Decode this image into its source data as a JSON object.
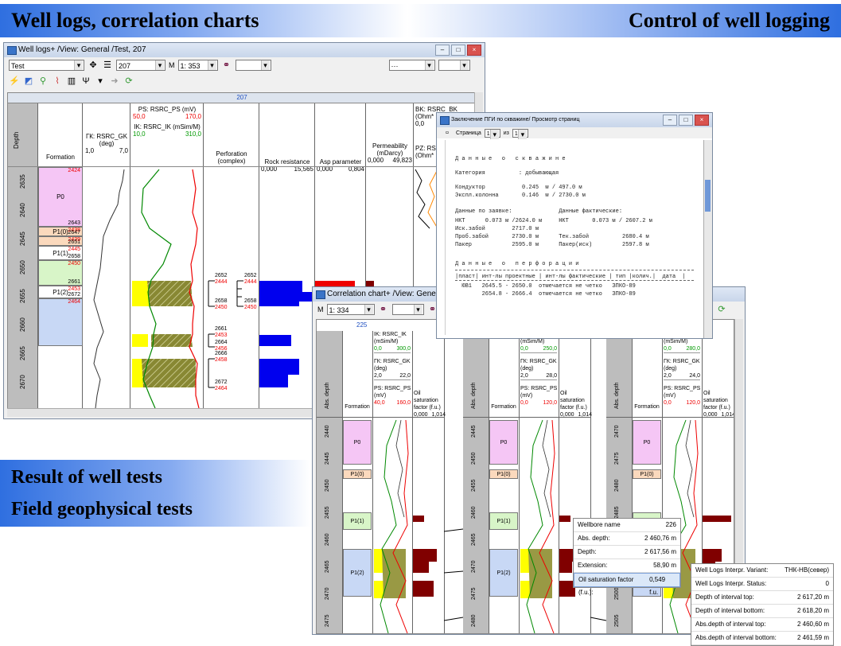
{
  "banners": {
    "top_left": "Well logs, correlation charts",
    "top_right": "Control of well logging",
    "lower_1": "Result of well tests",
    "lower_2": "Field geophysical tests"
  },
  "wl": {
    "title": "Well logs+ /View: General /Test, 207",
    "combo_test": "Test",
    "combo_well": "207",
    "scale_label": "M",
    "scale_value": "1: 353",
    "combo_dots": "···",
    "well_no": "207",
    "columns": {
      "depth": "Depth",
      "formation": "Formation",
      "gk_name": "ГК: RSRC_GK",
      "gk_unit": "(deg)",
      "gk_min": "1,0",
      "gk_max": "7,0",
      "ps_name": "PS: RSRC_PS (mV)",
      "ps_min": "50,0",
      "ps_max": "170,0",
      "ik_name": "IK: RSRC_IK (mSim/M)",
      "ik_min": "10,0",
      "ik_max": "310,0",
      "perf_1": "Perforation",
      "perf_2": "(complex)",
      "rock": "Rock resistance",
      "rock_min": "0,000",
      "rock_max": "15,565",
      "asp": "Asp parameter",
      "asp_min": "0,000",
      "asp_max": "0,804",
      "perm_1": "Permeability",
      "perm_2": "(mDarcy)",
      "perm_min": "0,000",
      "perm_max": "49,823",
      "bk_1": "BK: RSRC_BK",
      "bk_2": "(Ohm*",
      "bk_min": "0,0",
      "pz_1": "PZ: RS",
      "pz_2": "(Ohm*"
    },
    "depth_ticks": [
      "2635",
      "2640",
      "2645",
      "2650",
      "2655",
      "2660",
      "2665",
      "2670"
    ],
    "zones": [
      {
        "name": "P0",
        "top": "2424",
        "bottom": "2643"
      },
      {
        "name": "P1(0)",
        "top": "2438",
        "bottom": "2647"
      },
      {
        "name": "",
        "top": "2439",
        "bottom": "2651"
      },
      {
        "name": "P1(1)",
        "top": "2445",
        "bottom": "2658"
      },
      {
        "name": "",
        "top": "2450",
        "bottom": "2661"
      },
      {
        "name": "P1(2)",
        "top": "2453",
        "bottom": "2672"
      },
      {
        "name": "",
        "top": "2464",
        "bottom": ""
      }
    ],
    "perf_marks_a": [
      {
        "black": "2652",
        "red": "2444"
      },
      {
        "black": "2658",
        "red": "2450"
      },
      {
        "black": "2661",
        "red": "2453"
      },
      {
        "black": "2664",
        "red": "2456"
      },
      {
        "black": "2666",
        "red": "2458"
      },
      {
        "black": "2672",
        "red": "2464"
      }
    ],
    "perf_marks_b": [
      {
        "black": "2652",
        "red": "2444"
      },
      {
        "black": "2658",
        "red": "2450"
      }
    ]
  },
  "report": {
    "title": "Заключение ПГИ по скважине/ Просмотр страниц",
    "page_label": "Страница",
    "page_no": "1",
    "page_of": "из",
    "page_total": "1",
    "lines": [
      "Д а н н ы е   о   с к в а ж и н е",
      "Категория          : добывающая",
      "Кондуктор           0.245  м / 497.0 м",
      "Экспл.колонна       0.146  м / 2730.0 м",
      "Данные по заявке:              Данные фактические:",
      "НКТ      0.073 м /2624.0 м     НКТ       0.073 м / 2607.2 м",
      "Иск.забой        2717.0 м",
      "Проб.забой       2730.0 м      Тек.забой          2680.4 м",
      "Пакер            2595.0 м      Пакер(иск)         2597.8 м",
      "Д а н н ы е   о   п е р ф о р а ц и и",
      "|пласт| инт-лы проектные | инт-лы фактические | тип |колич.|  дата  |",
      "  ЮВ1   2645.5 - 2650.0  отмечается не четко   ЗПКО-89",
      "        2654.8 - 2666.4  отмечается не четко   ЗПКО-89"
    ]
  },
  "cc": {
    "title": "Correlation chart+ /View: General /Test, 225",
    "scale_label": "M",
    "scale_value": "1: 334",
    "well_no": "225",
    "abs_depth": "Abs. depth",
    "formation": "Formation",
    "ik_1": "IK: RSRC_IK",
    "ik_2": "(mSim/M)",
    "ik_min": "0,0",
    "ik_max": "300,0",
    "gk_1": "ГК: RSRC_GK",
    "gk_2": "(deg)",
    "gk_min": "2,0",
    "gk_max": "22,0",
    "ps_1": "PS: RSRC_PS",
    "ps_2": "(mV)",
    "ps_min": "40,0",
    "ps_max": "160,0",
    "osf_1": "Oil saturation",
    "osf_2": "factor (f.u.)",
    "osf_min": "0,000",
    "osf_max": "1,014",
    "w2": {
      "ik_max": "250,0",
      "ik_2": "(mSim/M)",
      "gk_max": "28,0",
      "ps_min": "0,0",
      "ps_max": "120,0"
    },
    "w3": {
      "ik_max": "280,0",
      "gk_max": "24,0",
      "ps_min": "0,0",
      "ps_max": "120,0"
    },
    "ticks_1": [
      "2440",
      "2445",
      "2450",
      "2455",
      "2460",
      "2465",
      "2470",
      "2475"
    ],
    "ticks_2": [
      "2445",
      "2450",
      "2455",
      "2460",
      "2465",
      "2470",
      "2475",
      "2480"
    ],
    "ticks_3": [
      "2470",
      "2475",
      "2480",
      "2485",
      "2490",
      "2495",
      "2500",
      "2505"
    ],
    "zone_names": [
      "P0",
      "P1(0)",
      "P1(1)",
      "P1(2)"
    ]
  },
  "tooltip_a": {
    "rows": [
      {
        "k": "Wellbore name",
        "v": "226"
      },
      {
        "k": "Abs. depth:",
        "v": "2 460,76 m"
      },
      {
        "k": "Depth:",
        "v": "2 617,56 m"
      },
      {
        "k": "Extension:",
        "v": "58,90 m"
      },
      {
        "k": "Oil saturation factor (f.u.):",
        "v": "0,549 f.u."
      }
    ]
  },
  "tooltip_b": {
    "rows": [
      {
        "k": "Well Logs Interpr. Variant:",
        "v": "ТНК-НВ(север)"
      },
      {
        "k": "Well Logs Interpr. Status:",
        "v": "0"
      },
      {
        "k": "Depth of interval top:",
        "v": "2 617,20 m"
      },
      {
        "k": "Depth of interval bottom:",
        "v": "2 618,20 m"
      },
      {
        "k": "Abs.depth of interval top:",
        "v": "2 460,60 m"
      },
      {
        "k": "Abs.depth of interval bottom:",
        "v": "2 461,59 m"
      }
    ]
  },
  "colors": {
    "p0": "#f5c6f5",
    "p10": "#fbd9bd",
    "p11": "#d8f5c8",
    "p12": "#c8d8f5",
    "yellow": "#ffff00",
    "blue": "#0000ee",
    "darkred": "#800000",
    "red": "#ff0000"
  }
}
